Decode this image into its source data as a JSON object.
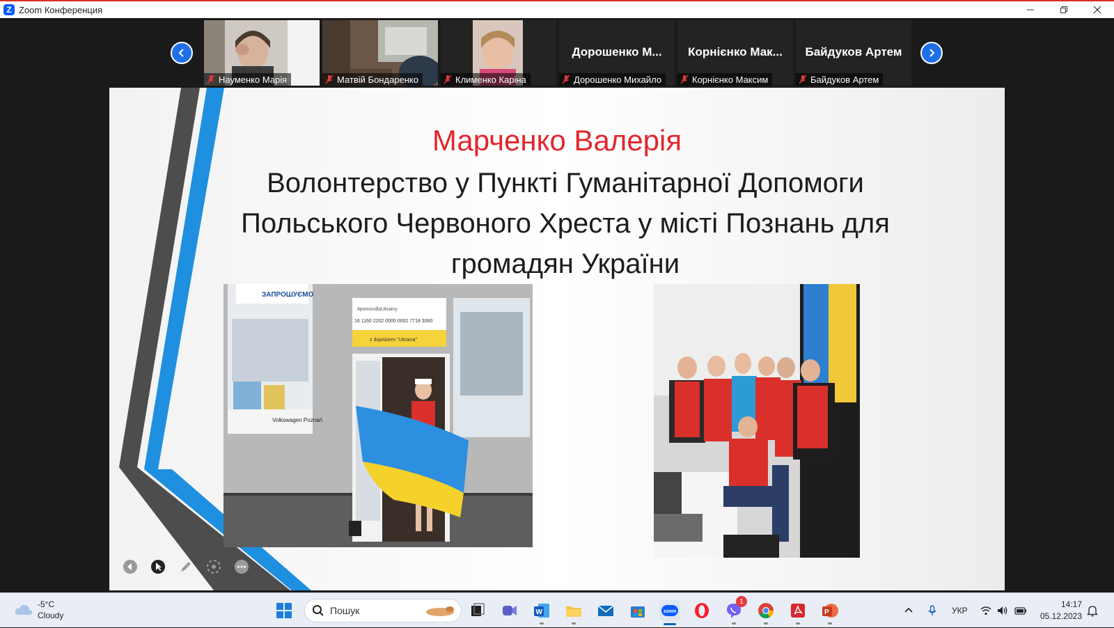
{
  "window": {
    "title": "Zoom Конференция"
  },
  "participants": {
    "video_tiles": [
      {
        "name": "Науменко Марія"
      },
      {
        "name": "Матвій Бондаренко"
      },
      {
        "name": "Клименко Каріна"
      }
    ],
    "name_tiles": [
      {
        "display": "Дорошенко М...",
        "name": "Дорошенко Михайло"
      },
      {
        "display": "Корнієнко Мак...",
        "name": "Корнієнко Максим"
      },
      {
        "display": "Байдуков Артем",
        "name": "Байдуков Артем"
      }
    ]
  },
  "slide": {
    "name": "Марченко Валерія",
    "title_lines": [
      "Волонтерство у Пункті Гуманітарної Допомоги",
      "Польського Червоного Хреста у місті Познань для",
      "громадян України"
    ],
    "photo1_signs": {
      "welcome": "ЗАПРОШУЄМО",
      "hashtag": "#pomocdlaUkrainy",
      "account": "16 1160 2202 0000 0002 7718 3060",
      "dopisek": "z dopiskiem \"Ukraina\"",
      "vw": "Volkswagen Poznań"
    }
  },
  "taskbar": {
    "weather_temp": "-5°C",
    "weather_desc": "Cloudy",
    "search_placeholder": "Пошук",
    "viber_badge": "1",
    "lang": "УКР",
    "time": "14:17",
    "date": "05.12.2023"
  },
  "colors": {
    "accent_red": "#e3262e",
    "zoom_blue": "#0b5cff",
    "slide_blue": "#1f8fe0"
  }
}
